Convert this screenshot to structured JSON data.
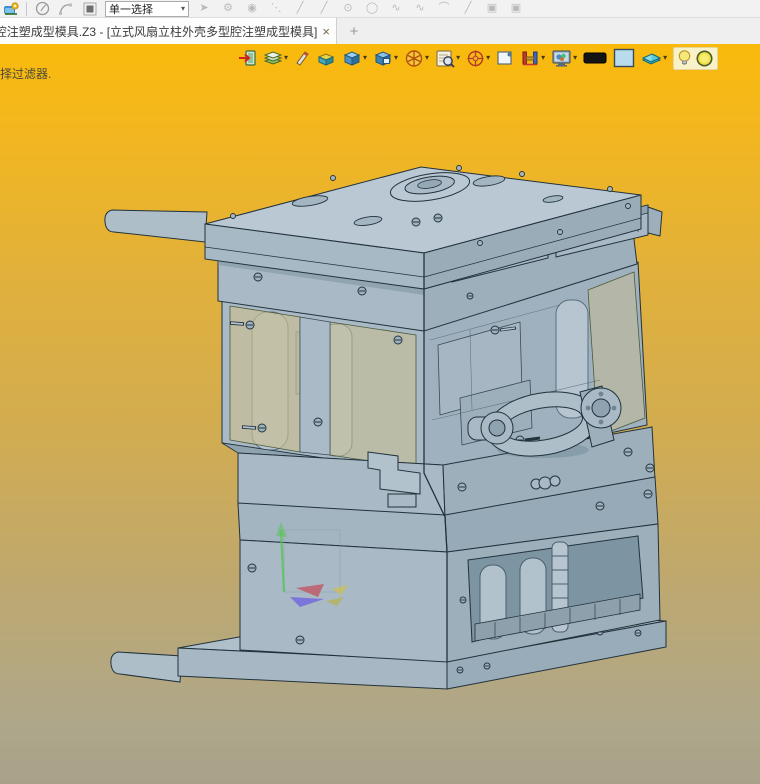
{
  "window": {
    "tab_title": "腔注塑成型模具.Z3 - [立式风扇立柱外壳多型腔注塑成型模具]",
    "tab_close_glyph": "×",
    "new_tab_glyph": "+"
  },
  "toolbar_top": {
    "selection_mode_value": "单一选择",
    "caret_glyph": "▾",
    "disabled_icons": [
      "➤",
      "⚙",
      "◉",
      "⋱",
      "╱",
      "╱",
      "⊙",
      "◯",
      "∿",
      "∿",
      "⌒",
      "╱",
      "▣",
      "▣"
    ]
  },
  "toolbar_view": {
    "caret_glyph": "▾",
    "icon_names": [
      "exit",
      "layers-visibility",
      "erase",
      "show-target",
      "shaded-cube",
      "display-mode",
      "section-wheel",
      "zoom-preview",
      "view-compass",
      "window-select",
      "clamp",
      "render-settings",
      "black-swatch",
      "blue-swatch",
      "material-book",
      "light-toggle",
      "background-color"
    ]
  },
  "statusbar": {
    "hint_text": "择过滤器."
  },
  "viewport": {
    "background_top": "#f9ba0b",
    "background_middle": "#d2ac50",
    "background_bottom": "#a9a189",
    "model_body_color": "#aebfca",
    "model_face_dark_color": "#9cafbb",
    "model_window_color": "#c9be90",
    "model_outline_color": "#22323c",
    "triad_axis_colors": {
      "x": "#c05a6a",
      "y": "#58c558",
      "z": "#6a5ae0"
    }
  }
}
